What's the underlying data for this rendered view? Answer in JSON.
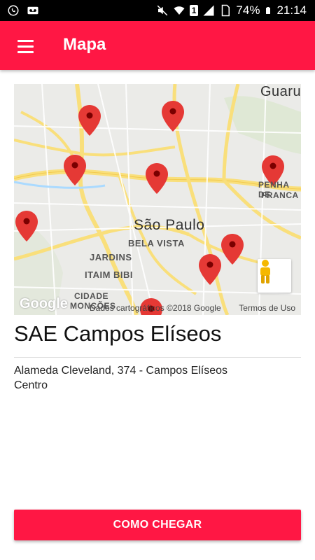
{
  "status_bar": {
    "battery": "74%",
    "time": "21:14",
    "sim_label": "1",
    "icons": [
      "whatsapp-icon",
      "voicemail-icon",
      "mute-icon",
      "wifi-icon",
      "sim-icon",
      "signal-icon",
      "battery-icon"
    ]
  },
  "app_bar": {
    "title": "Mapa",
    "menu_icon": "hamburger-menu-icon",
    "color": "#FF1744"
  },
  "map": {
    "city_label": "São Paulo",
    "area_labels": {
      "guaru": "Guaru",
      "penha_1": "PENHA DE",
      "penha_2": "FRANCA",
      "bela_vista": "BELA VISTA",
      "jardins": "JARDINS",
      "itaim_bibi": "ITAIM BIBI",
      "cidade_1": "CIDADE",
      "cidade_2": "MONCÕES"
    },
    "google_logo": "Google",
    "attribution": "Dados cartográficos ©2018 Google",
    "terms": "Termos de Uso",
    "marker_count": 10
  },
  "place": {
    "name": "SAE Campos Elíseos",
    "address_line1": "Alameda Cleveland, 374 - Campos Elíseos",
    "address_line2": "Centro"
  },
  "cta": {
    "label": "COMO CHEGAR"
  }
}
